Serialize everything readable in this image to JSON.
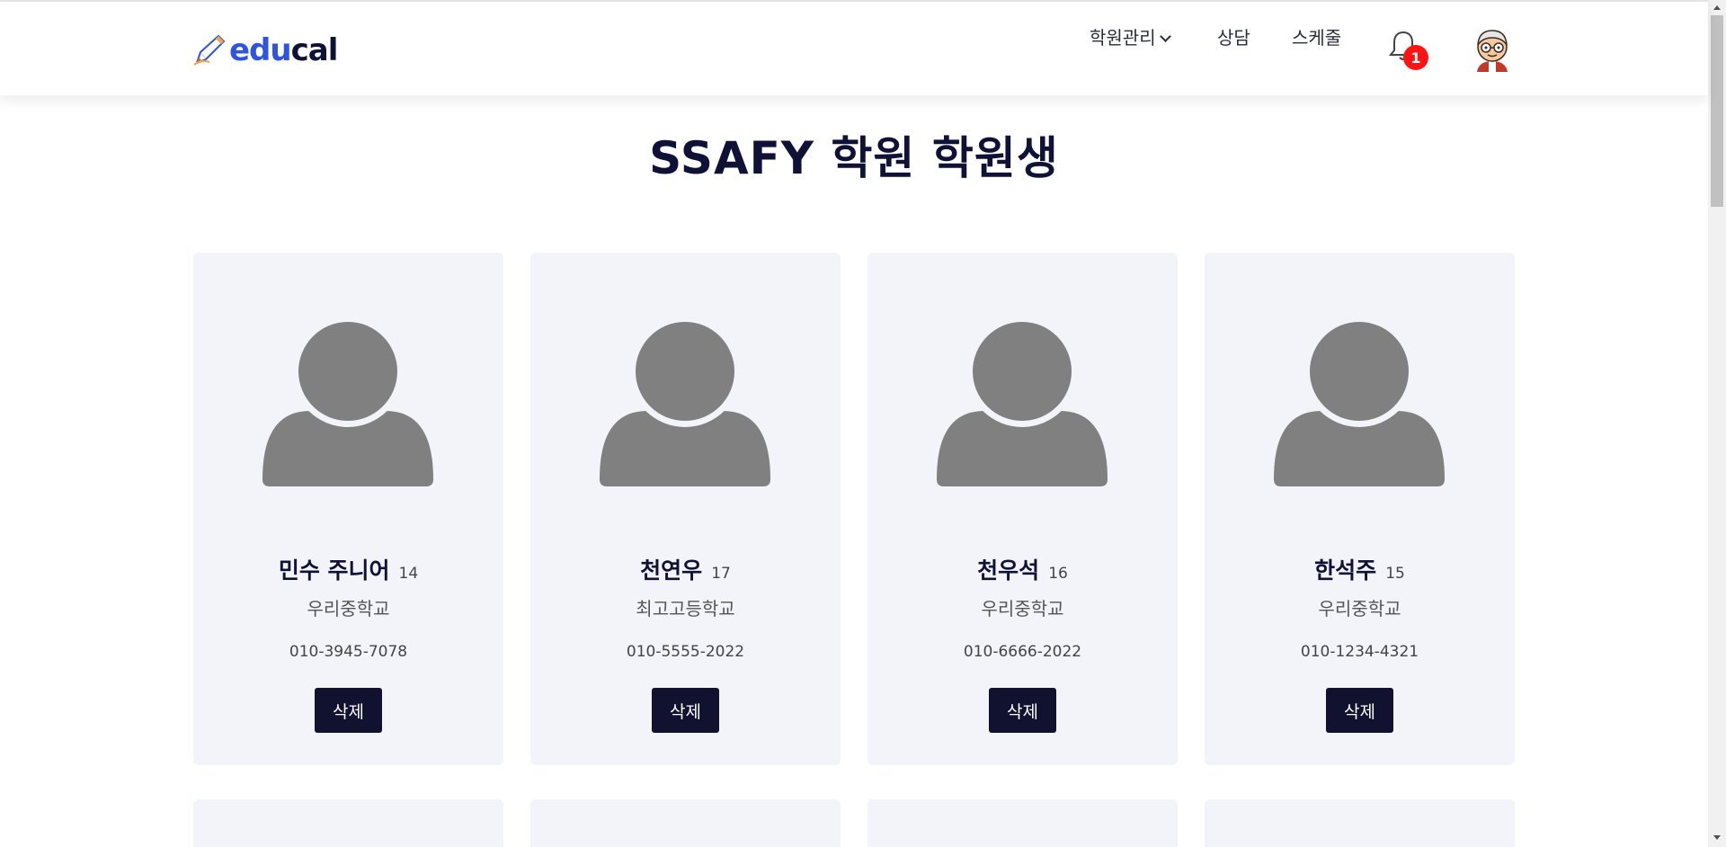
{
  "header": {
    "logo": {
      "accent": "edu",
      "rest": "cal"
    },
    "nav": {
      "academy_manage": "학원관리",
      "consult": "상담",
      "schedule": "스케줄"
    },
    "notification_count": "1"
  },
  "page": {
    "title": "SSAFY 학원 학원생"
  },
  "students": [
    {
      "name": "민수 주니어",
      "age": "14",
      "school": "우리중학교",
      "phone": "010-3945-7078",
      "delete_label": "삭제"
    },
    {
      "name": "천연우",
      "age": "17",
      "school": "최고고등학교",
      "phone": "010-5555-2022",
      "delete_label": "삭제"
    },
    {
      "name": "천우석",
      "age": "16",
      "school": "우리중학교",
      "phone": "010-6666-2022",
      "delete_label": "삭제"
    },
    {
      "name": "한석주",
      "age": "15",
      "school": "우리중학교",
      "phone": "010-1234-4321",
      "delete_label": "삭제"
    }
  ],
  "colors": {
    "brand_blue": "#2f55e0",
    "navy": "#10122f",
    "card_bg": "#f3f4f9",
    "badge_red": "#ff1313",
    "avatar_gray": "#808080"
  }
}
